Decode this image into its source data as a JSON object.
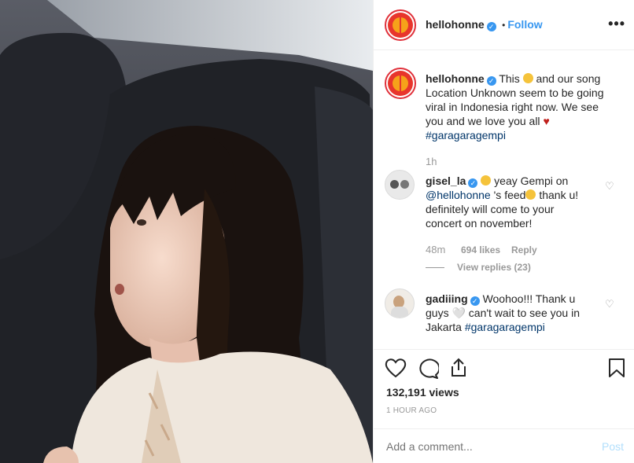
{
  "post": {
    "username": "hellohonne",
    "follow_label": "Follow",
    "separator": "•",
    "more_label": "•••"
  },
  "caption": {
    "username": "hellohonne",
    "line1a": "This",
    "line1b": "and our song",
    "line2": "Location Unknown seem to be going",
    "line3": "viral in Indonesia right now. We see",
    "line4": "you and we love you all",
    "hashtag": "#garagaragempi",
    "time": "1h"
  },
  "comments": [
    {
      "username": "gisel_la",
      "line1": "yeay Gempi on",
      "mention": "@hellohonne",
      "line2": "'s feed",
      "line2b": "thank u!",
      "line3": "definitely will come to your",
      "line4": "concert on november!",
      "time": "48m",
      "likes": "694 likes",
      "reply_label": "Reply",
      "view_replies": "View replies (23)"
    },
    {
      "username": "gadiiing",
      "line1": "Woohoo!!! Thank u",
      "line2": "guys 🤍 can't wait to see you in",
      "line3": "Jakarta",
      "hashtag": "#garagaragempi"
    }
  ],
  "stats": {
    "views": "132,191 views",
    "time_ago": "1 HOUR AGO"
  },
  "add_comment": {
    "placeholder": "Add a comment...",
    "post_label": "Post"
  },
  "colors": {
    "link_blue": "#3897f0",
    "hashtag": "#003569",
    "muted": "#999999",
    "heart_red": "#ed4956"
  },
  "icons": [
    "verified-badge-icon",
    "more-options-icon",
    "like-icon",
    "comment-icon",
    "share-icon",
    "save-icon",
    "comment-like-icon"
  ]
}
